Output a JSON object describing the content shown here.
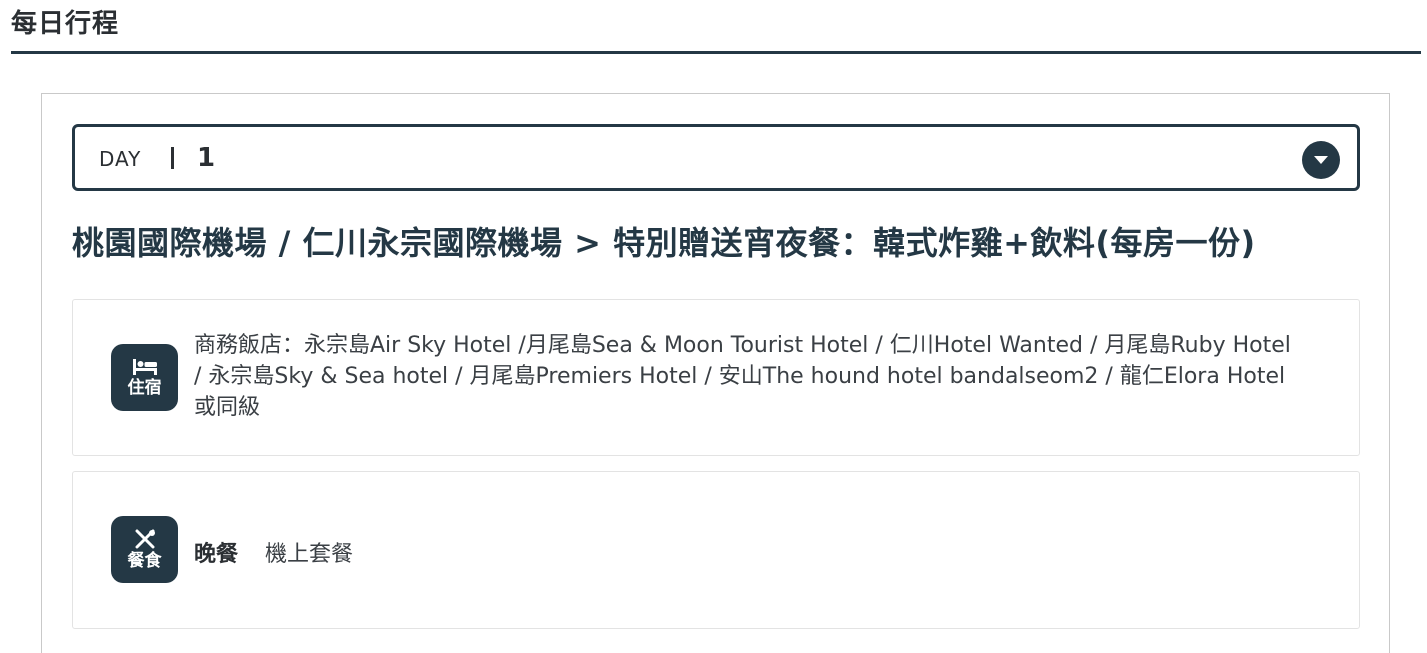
{
  "section": {
    "title": "每日行程"
  },
  "day": {
    "label": "DAY",
    "number": "1"
  },
  "route": {
    "title": "桃園國際機場 / 仁川永宗國際機場 > 特別贈送宵夜餐：韓式炸雞+飲料(每房一份)"
  },
  "hotel": {
    "badge_label": "住宿",
    "icon": "bed-icon",
    "text": "商務飯店：永宗島Air Sky Hotel /月尾島Sea & Moon Tourist Hotel / 仁川Hotel Wanted / 月尾島Ruby Hotel / 永宗島Sky & Sea hotel / 月尾島Premiers Hotel / 安山The hound hotel bandalseom2 / 龍仁Elora Hotel或同級"
  },
  "meal": {
    "badge_label": "餐食",
    "icon": "utensils-icon",
    "label": "晚餐",
    "value": "機上套餐"
  },
  "colors": {
    "accent": "#243845",
    "border": "#e3e3e3",
    "text": "#2b2f33"
  }
}
